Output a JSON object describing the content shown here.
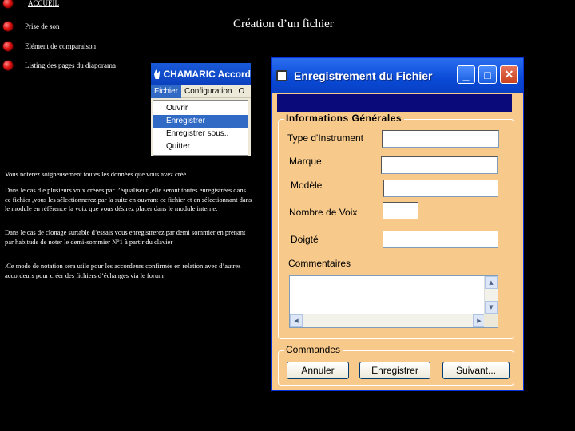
{
  "nav": {
    "items": [
      {
        "label": "ACCUEIL"
      },
      {
        "label": "Prise de son"
      },
      {
        "label": "Elément de comparaison"
      },
      {
        "label": "Listing des pages du diaporama"
      }
    ]
  },
  "page_title": "Création d’un fichier",
  "menu_screenshot": {
    "app_title": "CHAMARIC Accord",
    "menubar": [
      "Fichier",
      "Configuration",
      "O"
    ],
    "dropdown": [
      "Ouvrir",
      "Enregistrer",
      "Enregistrer sous..",
      "Quitter"
    ],
    "highlighted": "Enregistrer"
  },
  "paragraphs": [
    "Vous noterez soigneusement toutes les données que vous avez créé.",
    "Dans le cas d e plusieurs voix créées par l’équaliseur ,elle seront toutes enregistrées dans ce fichier ,vous les sélectionnerez par la suite en ouvrant ce fichier et en sélectionnant dans le module en référence la voix que vous désirez placer dans le module interne.",
    "Dans le cas de clonage surtable d’essais vous enregistrerez par demi sommier en prenant par habitude de noter le demi-sommier N°1 à partir du clavier",
    ".Ce mode de notation sera utile pour les accordeurs confirmés en relation avec d’autres accordeurs pour créer des fichiers d’échanges via le forum"
  ],
  "dialog": {
    "title": "Enregistrement du Fichier",
    "minimize": "_",
    "maximize": "□",
    "close": "✕",
    "group_info": "Informations Générales",
    "fields": {
      "type_label": "Type d'Instrument",
      "type_value": "",
      "marque_label": "Marque",
      "marque_value": "",
      "modele_label": "Modèle",
      "modele_value": "",
      "voix_label": "Nombre de Voix",
      "voix_value": "",
      "doigte_label": "Doigté",
      "doigte_value": "",
      "comments_label": "Commentaires"
    },
    "group_commands": "Commandes",
    "buttons": {
      "cancel": "Annuler",
      "save": "Enregistrer",
      "next": "Suivant..."
    }
  },
  "colors": {
    "dialog_bg": "#f7c98b",
    "titlebar": "#0a4ad6",
    "band": "#0a0a7a",
    "bullet": "#e01010"
  }
}
